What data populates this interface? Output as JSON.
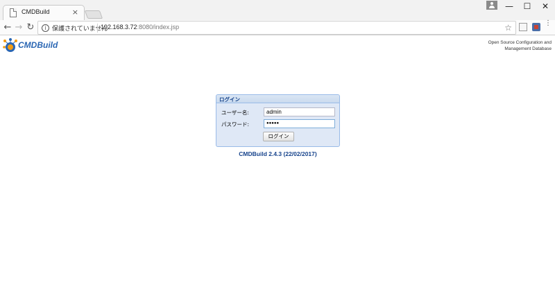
{
  "browser": {
    "tab_title": "CMDBuild",
    "tab_close": "×",
    "security_label": "保護されていません",
    "url_host": "192.168.3.72",
    "url_rest": ":8080/index.jsp",
    "window_controls": {
      "minimize": "—",
      "maximize": "☐",
      "close": "✕"
    }
  },
  "icons": {
    "back": "←",
    "forward": "→",
    "reload": "↻",
    "info": "i",
    "star": "☆",
    "menu": "⋮"
  },
  "header": {
    "logo_text": "CMDBuild",
    "tagline_line1": "Open Source Configuration and",
    "tagline_line2": "Management Database"
  },
  "login": {
    "title": "ログイン",
    "username_label": "ユーザー名:",
    "username_value": "admin",
    "password_label": "パスワード:",
    "password_value": "●●●●●",
    "submit_label": "ログイン"
  },
  "footer": {
    "version": "CMDBuild 2.4.3 (22/02/2017)"
  },
  "colors": {
    "panel_bg": "#dfe8f6",
    "panel_border": "#99bbe8",
    "title_blue": "#15428b",
    "logo_blue": "#2a66b3",
    "logo_orange": "#f39c12"
  }
}
